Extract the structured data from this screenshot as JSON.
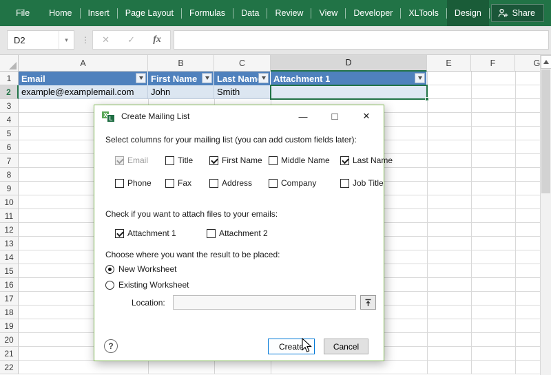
{
  "ribbon": {
    "tabs": [
      "File",
      "Home",
      "Insert",
      "Page Layout",
      "Formulas",
      "Data",
      "Review",
      "View",
      "Developer",
      "XLTools",
      "Design"
    ],
    "active_tab": "Design",
    "share_label": "Share"
  },
  "formula_strip": {
    "name_box_value": "D2",
    "cancel_glyph": "✕",
    "confirm_glyph": "✓",
    "function_glyph": "fx",
    "formula_value": ""
  },
  "grid": {
    "column_headers": [
      "A",
      "B",
      "C",
      "D",
      "E",
      "F",
      "G"
    ],
    "active_column": "D",
    "row_count": 22,
    "active_row": 2,
    "selected_cell": "D2",
    "table_headers": [
      "Email",
      "First Name",
      "Last Name",
      "Attachment 1"
    ],
    "data_row": [
      "example@examplemail.com",
      "John",
      "Smith",
      ""
    ]
  },
  "dialog": {
    "title": "Create Mailing List",
    "window_buttons": {
      "minimize": "—",
      "maximize": "□",
      "close": "✕"
    },
    "select_columns": {
      "label": "Select columns for your mailing list (you can add custom fields later):",
      "row1": [
        {
          "label": "Email",
          "checked": true,
          "disabled": true
        },
        {
          "label": "Title",
          "checked": false,
          "disabled": false
        },
        {
          "label": "First Name",
          "checked": true,
          "disabled": false
        },
        {
          "label": "Middle Name",
          "checked": false,
          "disabled": false
        },
        {
          "label": "Last Name",
          "checked": true,
          "disabled": false
        }
      ],
      "row2": [
        {
          "label": "Phone",
          "checked": false,
          "disabled": false
        },
        {
          "label": "Fax",
          "checked": false,
          "disabled": false
        },
        {
          "label": "Address",
          "checked": false,
          "disabled": false
        },
        {
          "label": "Company",
          "checked": false,
          "disabled": false
        },
        {
          "label": "Job Title",
          "checked": false,
          "disabled": false
        }
      ]
    },
    "attachments": {
      "label": "Check if you want to attach files to your emails:",
      "items": [
        {
          "label": "Attachment 1",
          "checked": true,
          "disabled": false
        },
        {
          "label": "Attachment 2",
          "checked": false,
          "disabled": false
        }
      ]
    },
    "placement": {
      "label": "Choose where you want the result to be placed:",
      "options": [
        {
          "label": "New Worksheet",
          "selected": true
        },
        {
          "label": "Existing Worksheet",
          "selected": false
        }
      ],
      "location_label": "Location:",
      "location_value": ""
    },
    "footer": {
      "help_label": "?",
      "create_label": "Create",
      "cancel_label": "Cancel"
    }
  },
  "colors": {
    "ribbon_green": "#217346",
    "active_tab_green": "#1a5c38",
    "table_header_blue": "#4f81bd",
    "table_row_blue": "#dce6f1",
    "selection_green": "#217346",
    "create_border_blue": "#0078d7",
    "dialog_border_green": "#7cb74e"
  }
}
